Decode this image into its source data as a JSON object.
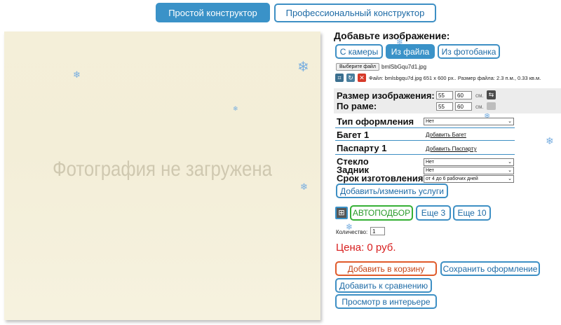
{
  "tabs": {
    "simple": "Простой конструктор",
    "pro": "Профессиональный конструктор"
  },
  "preview": {
    "placeholder": "Фотография не загружена"
  },
  "upload": {
    "heading": "Добавьте изображение:",
    "camera": "С камеры",
    "file": "Из файла",
    "photobank": "Из фотобанка",
    "choose_file": "Выберите файл",
    "file_name": "bmlSbGqu7d1.jpg",
    "file_info": "Файл: bmlsbgqu7d.jpg 651 х 600 px.. Размер файла: 2.3 п.м., 0.33 кв.м."
  },
  "size": {
    "image_label": "Размер изображения:",
    "frame_label": "По раме:",
    "image_w": "55",
    "image_h": "60",
    "frame_w": "55",
    "frame_h": "60",
    "unit": "см."
  },
  "design": {
    "type_label": "Тип оформления",
    "type_value": "Нет",
    "baget_label": "Багет 1",
    "baget_link": "Добавить Багет",
    "passe_label": "Паспарту 1",
    "passe_link": "Добавить Паспарту",
    "glass_label": "Стекло",
    "glass_value": "Нет",
    "back_label": "Задник",
    "back_value": "Нет",
    "term_label": "Срок изготовления",
    "term_value": "от 4 до 6 рабочих дней",
    "services_btn": "Добавить/изменить услуги"
  },
  "autopick": {
    "auto": "АВТОПОДБОР",
    "more3": "Еще 3",
    "more10": "Еще 10"
  },
  "qty": {
    "label": "Количество:",
    "value": "1"
  },
  "price": {
    "label": "Цена:",
    "value": "0",
    "currency": "руб."
  },
  "actions": {
    "cart": "Добавить в корзину",
    "save": "Сохранить оформление",
    "compare": "Добавить к сравнению",
    "interior": "Просмотр в интерьере"
  },
  "colors": {
    "accent": "#3a92c8",
    "green": "#35b035",
    "red": "#d81e1e",
    "orange": "#e05a2a"
  }
}
